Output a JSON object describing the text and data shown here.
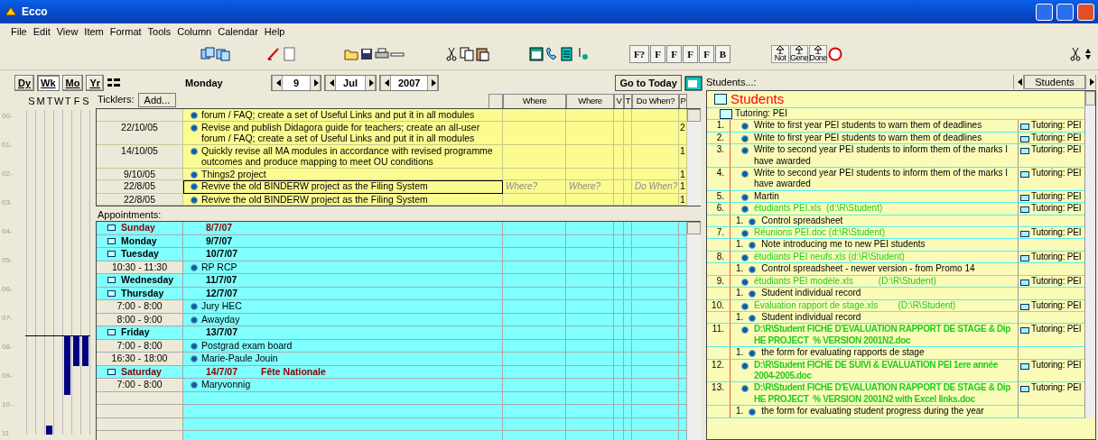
{
  "window": {
    "title": "Ecco"
  },
  "menu": [
    "File",
    "Edit",
    "View",
    "Item",
    "Format",
    "Tools",
    "Column",
    "Calendar",
    "Help"
  ],
  "toolbar": {
    "text_buttons": [
      "F?",
      "F",
      "F",
      "F",
      "F",
      "B"
    ],
    "status_buttons": [
      "Not",
      "Gene",
      "Done"
    ]
  },
  "calendar_nav": {
    "views": [
      {
        "label": "Dy",
        "selected": false
      },
      {
        "label": "Wk",
        "selected": true
      },
      {
        "label": "Mo",
        "selected": false
      },
      {
        "label": "Yr",
        "selected": false
      }
    ],
    "weekday": "Monday",
    "day": "9",
    "month": "Jul",
    "year": "2007",
    "today_button": "Go to Today"
  },
  "week_grid": {
    "day_letters": [
      "S",
      "M",
      "T",
      "W",
      "T",
      "F",
      "S"
    ],
    "hours": [
      "00-",
      "01-",
      "02-",
      "03-",
      "04-",
      "05-",
      "06-",
      "07-",
      "08-",
      "09-",
      "10 -",
      "11"
    ]
  },
  "ticklers": {
    "label": "Ticklers:",
    "add_button": "Add...",
    "columns": [
      "Where",
      "Where",
      "V",
      "T",
      "Do When?",
      "P"
    ],
    "rows": [
      {
        "date": "",
        "text": "forum / FAQ; create a set of Useful Links and put it in all modules",
        "p": "",
        "selected": false
      },
      {
        "date": "22/10/05",
        "text": "Revise and publish Didagora guide for teachers; create an all-user forum / FAQ; create a set of Useful Links and put it in all modules",
        "p": "2",
        "selected": false
      },
      {
        "date": "14/10/05",
        "text": "Quickly revise all MA modules in accordance with revised programme outcomes and produce mapping to meet OU conditions",
        "p": "1",
        "selected": false
      },
      {
        "date": "9/10/05",
        "text": "Things2 project",
        "p": "1",
        "selected": false
      },
      {
        "date": "22/8/05",
        "text": "Revive the old BINDERW project as the Filing System",
        "p": "1",
        "selected": true,
        "where_placeholder": "Where?",
        "where_2_placeholder": "Where?",
        "do_when_placeholder": "Do When?"
      },
      {
        "date": "22/8/05",
        "text": "Revive the old BINDERW project as the Filing System",
        "p": "1",
        "selected": false
      }
    ]
  },
  "appointments": {
    "label": "Appointments:",
    "rows": [
      {
        "kind": "day",
        "day": "Sunday",
        "date": "8/7/07",
        "weekend": true
      },
      {
        "kind": "day",
        "day": "Monday",
        "date": "9/7/07",
        "weekend": false
      },
      {
        "kind": "day",
        "day": "Tuesday",
        "date": "10/7/07",
        "weekend": false
      },
      {
        "kind": "appointment",
        "time": "10:30 - 11:30",
        "text": "RP RCP"
      },
      {
        "kind": "day",
        "day": "Wednesday",
        "date": "11/7/07",
        "weekend": false
      },
      {
        "kind": "day",
        "day": "Thursday",
        "date": "12/7/07",
        "weekend": false
      },
      {
        "kind": "appointment",
        "time": "7:00 - 8:00",
        "text": "Jury HEC"
      },
      {
        "kind": "appointment",
        "time": "8:00 - 9:00",
        "text": "Awayday"
      },
      {
        "kind": "day",
        "day": "Friday",
        "date": "13/7/07",
        "weekend": false
      },
      {
        "kind": "appointment",
        "time": "7:00 - 8:00",
        "text": "Postgrad exam board"
      },
      {
        "kind": "appointment",
        "time": "16:30 - 18:00",
        "text": "Marie-Paule Jouin"
      },
      {
        "kind": "day",
        "day": "Saturday",
        "date": "14/7/07",
        "note": "Fête Nationale",
        "weekend": true
      },
      {
        "kind": "appointment",
        "time": "7:00 - 8:00",
        "text": "Maryvonnig"
      }
    ]
  },
  "students": {
    "label": "Students...:",
    "column": "Students",
    "title": "Students",
    "group": "Tutoring: PEI",
    "items": [
      {
        "number": "1.",
        "kind": "task",
        "text": "Write to first year PEI students to warn them of deadlines",
        "folder": "Tutoring: PEI"
      },
      {
        "number": "2.",
        "kind": "task",
        "text": "Write to first year PEI students to warn them of deadlines",
        "folder": "Tutoring: PEI"
      },
      {
        "number": "3.",
        "kind": "task",
        "text": "Write to second year PEI students to inform them of the marks I have awarded",
        "folder": "Tutoring: PEI"
      },
      {
        "number": "4.",
        "kind": "task",
        "text": "Write to second year PEI students to inform them of the marks I have awarded",
        "folder": "Tutoring: PEI"
      },
      {
        "number": "5.",
        "kind": "task",
        "text": "Martin",
        "folder": "Tutoring: PEI"
      },
      {
        "number": "6.",
        "kind": "file",
        "text": "étudiants PEI.xls  (d:\\R\\Student)",
        "folder": "Tutoring: PEI",
        "children": [
          {
            "number": "1.",
            "text": "Control spreadsheet"
          }
        ]
      },
      {
        "number": "7.",
        "kind": "file",
        "text": "Réunions PEI.doc (d:\\R\\Student)",
        "folder": "Tutoring: PEI",
        "children": [
          {
            "number": "1.",
            "text": "Note introducing me to new PEI students"
          }
        ]
      },
      {
        "number": "8.",
        "kind": "file",
        "text": "étudiants PEI neufs.xls (d:\\R\\Student)",
        "folder": "Tutoring: PEI",
        "children": [
          {
            "number": "1.",
            "text": "Control spreadsheet - newer version - from Promo 14"
          }
        ]
      },
      {
        "number": "9.",
        "kind": "file",
        "text": "étudiants PEI modèle.xls          (D:\\R\\Student)",
        "folder": "Tutoring: PEI",
        "children": [
          {
            "number": "1.",
            "text": "Student individual record"
          }
        ]
      },
      {
        "number": "10.",
        "kind": "file",
        "text": "Evaluation rapport de stage.xls        (D:\\R\\Student)",
        "folder": "Tutoring: PEI",
        "children": [
          {
            "number": "1.",
            "text": "Student individual record"
          }
        ]
      },
      {
        "number": "11.",
        "kind": "file_bold",
        "text": "D:\\R\\Student FICHE D'EVALUATION RAPPORT DE STAGE & Dip HE PROJECT  % VERSION 2001N2.doc",
        "folder": "Tutoring: PEI",
        "children": [
          {
            "number": "1.",
            "text": "the form for evaluating rapports de stage"
          }
        ]
      },
      {
        "number": "12.",
        "kind": "file_bold",
        "text": "D:\\R\\Student FICHE DE SUIVI & EVALUATION PEI 1ere année 2004-2005.doc",
        "folder": "Tutoring: PEI"
      },
      {
        "number": "13.",
        "kind": "file_bold",
        "text": "D:\\R\\Student FICHE D'EVALUATION RAPPORT DE STAGE & Dip HE PROJECT  % VERSION 2001N2 with Excel links.doc",
        "folder": "Tutoring: PEI",
        "children": [
          {
            "number": "1.",
            "text": "the form for evaluating student progress during the year"
          }
        ]
      }
    ]
  }
}
